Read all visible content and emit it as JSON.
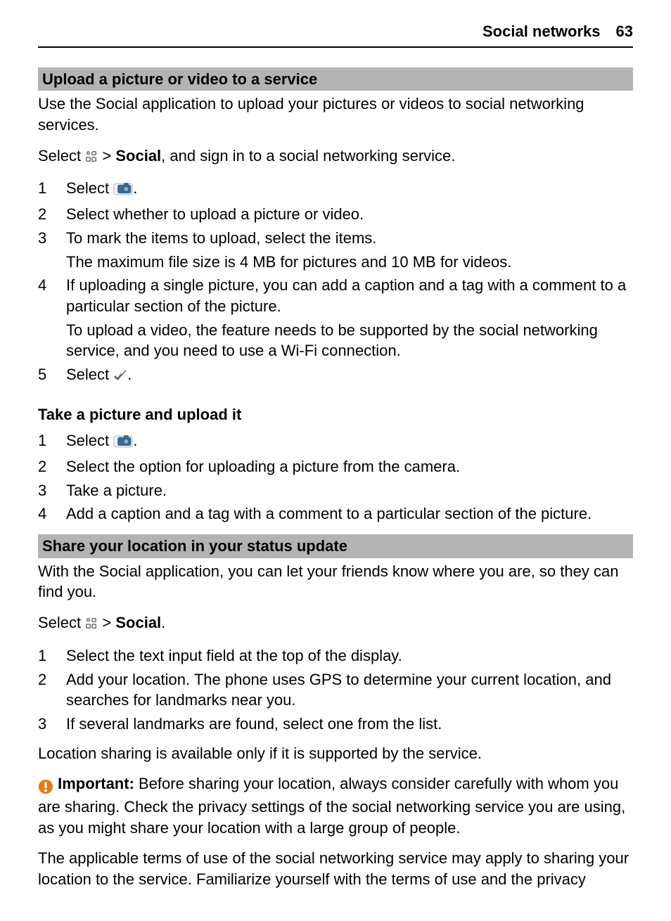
{
  "header": {
    "section": "Social networks",
    "page": "63"
  },
  "section1": {
    "title": "Upload a picture or video to a service",
    "intro": "Use the Social application to upload your pictures or videos to social networking services.",
    "select_prefix": "Select ",
    "select_mid": " > ",
    "select_bold": "Social",
    "select_suffix": ", and sign in to a social networking service.",
    "steps": [
      {
        "n": "1",
        "prefix": "Select ",
        "suffix": "."
      },
      {
        "n": "2",
        "text": "Select whether to upload a picture or video."
      },
      {
        "n": "3",
        "text": "To mark the items to upload, select the items.",
        "text2": "The maximum file size is 4 MB for pictures and 10 MB for videos."
      },
      {
        "n": "4",
        "text": "If uploading a single picture, you can add a caption and a tag with a comment to a particular section of the picture.",
        "text2": "To upload a video, the feature needs to be supported by the social networking service, and you need to use a Wi-Fi connection."
      },
      {
        "n": "5",
        "prefix": "Select ",
        "suffix": "."
      }
    ],
    "sub_title": "Take a picture and upload it",
    "sub_steps": [
      {
        "n": "1",
        "prefix": "Select ",
        "suffix": "."
      },
      {
        "n": "2",
        "text": "Select the option for uploading a picture from the camera."
      },
      {
        "n": "3",
        "text": "Take a picture."
      },
      {
        "n": "4",
        "text": "Add a caption and a tag with a comment to a particular section of the picture."
      }
    ]
  },
  "section2": {
    "title": "Share your location in your status update",
    "intro": "With the Social application, you can let your friends know where you are, so they can find you.",
    "select_prefix": "Select ",
    "select_mid": " > ",
    "select_bold": "Social",
    "select_suffix": ".",
    "steps": [
      {
        "n": "1",
        "text": "Select the text input field at the top of the display."
      },
      {
        "n": "2",
        "text": "Add your location. The phone uses GPS to determine your current location, and searches for landmarks near you."
      },
      {
        "n": "3",
        "text": "If several landmarks are found, select one from the list."
      }
    ],
    "note": "Location sharing is available only if it is supported by the service.",
    "important_label": "Important:",
    "important_text": " Before sharing your location, always consider carefully with whom you are sharing. Check the privacy settings of the social networking service you are using, as you might share your location with a large group of people.",
    "terms": "The applicable terms of use of the social networking service may apply to sharing your location to the service. Familiarize yourself with the terms of use and the privacy"
  }
}
